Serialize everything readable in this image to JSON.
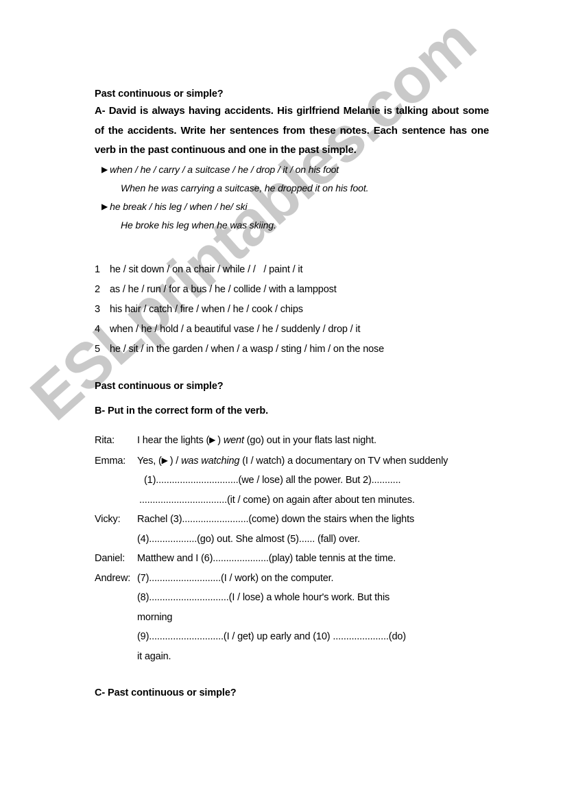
{
  "watermark": {
    "text": "ESLprintables.com",
    "color": "#c9c9c9"
  },
  "section_a": {
    "heading": "Past continuous or simple?",
    "instructions": "A- David is always having accidents. His girlfriend Melanie is talking about some of the accidents. Write her sentences from these notes. Each sentence has one verb in the past continuous and one in the past simple.",
    "bullet_glyph": "▶",
    "examples": [
      {
        "cue": "when / he / carry / a suitcase / he / drop / it / on his foot",
        "answer": "When he was carrying a suitcase, he dropped it on his foot."
      },
      {
        "cue": "he break / his leg / when / he/ ski",
        "answer": "He broke his leg when he was skiing."
      }
    ],
    "items": [
      {
        "number": "1",
        "text": "he / sit down / on a chair / while / /   / paint / it"
      },
      {
        "number": "2",
        "text": "as / he / run / for a bus / he / collide / with a lamppost"
      },
      {
        "number": "3",
        "text": "his hair / catch / fire / when / he / cook / chips"
      },
      {
        "number": "4",
        "text": "when / he / hold / a beautiful vase / he / suddenly / drop / it"
      },
      {
        "number": "5",
        "text": "he / sit / in the garden / when / a wasp / sting / him / on the nose"
      }
    ]
  },
  "section_b": {
    "heading": "Past continuous or simple?",
    "instructions": "B- Put in the correct form of the verb.",
    "lines": [
      {
        "speaker": "Rita:",
        "parts": [
          {
            "t": "I hear the lights ("
          },
          {
            "t": "▶",
            "style": "triangle"
          },
          {
            "t": ") "
          },
          {
            "t": "went",
            "style": "italic"
          },
          {
            "t": " (go) out in your flats last night."
          }
        ]
      },
      {
        "speaker": "Emma:",
        "parts": [
          {
            "t": "Yes, ("
          },
          {
            "t": "▶",
            "style": "triangle"
          },
          {
            "t": ") / "
          },
          {
            "t": "was watching",
            "style": "italic"
          },
          {
            "t": " (I / watch) a documentary on TV when suddenly"
          }
        ]
      },
      {
        "speaker": "",
        "indent": "ind-1",
        "parts": [
          {
            "t": "(1)"
          },
          {
            "t": "...............................",
            "style": "dots"
          },
          {
            "t": "(we / lose) all the power. But 2)"
          },
          {
            "t": "...........",
            "style": "dots"
          }
        ]
      },
      {
        "speaker": "",
        "indent": "ind-2",
        "parts": [
          {
            "t": ".................................",
            "style": "dots"
          },
          {
            "t": "(it / come) on again after about ten minutes."
          }
        ]
      },
      {
        "speaker": "Vicky:",
        "parts": [
          {
            "t": "Rachel (3)"
          },
          {
            "t": ".........................",
            "style": "dots"
          },
          {
            "t": "(come) down the stairs when the lights"
          }
        ]
      },
      {
        "speaker": "",
        "indent": "ind-3",
        "parts": [
          {
            "t": "(4)"
          },
          {
            "t": "..................",
            "style": "dots"
          },
          {
            "t": "(go) out. She almost (5)"
          },
          {
            "t": "......",
            "style": "dots"
          },
          {
            "t": "   (fall) over."
          }
        ]
      },
      {
        "speaker": "Daniel:",
        "parts": [
          {
            "t": "Matthew and I (6)"
          },
          {
            "t": ".....................",
            "style": "dots"
          },
          {
            "t": "(play) table tennis at the time."
          }
        ]
      },
      {
        "speaker": "Andrew:",
        "parts": [
          {
            "t": "(7)"
          },
          {
            "t": "...........................",
            "style": "dots"
          },
          {
            "t": "(I / work) on the computer."
          }
        ]
      },
      {
        "speaker": "",
        "indent": "ind-3",
        "parts": [
          {
            "t": "(8)"
          },
          {
            "t": "..............................",
            "style": "dots"
          },
          {
            "t": "(I / lose) a whole hour's work. But this"
          }
        ]
      },
      {
        "speaker": "",
        "indent": "ind-3",
        "parts": [
          {
            "t": "morning"
          }
        ]
      },
      {
        "speaker": "",
        "indent": "ind-3",
        "parts": [
          {
            "t": "(9)"
          },
          {
            "t": "............................",
            "style": "dots"
          },
          {
            "t": "(I / get) up early and (10) "
          },
          {
            "t": ".....................",
            "style": "dots"
          },
          {
            "t": "(do)"
          }
        ]
      },
      {
        "speaker": "",
        "indent": "ind-3",
        "parts": [
          {
            "t": "it again."
          }
        ]
      }
    ]
  },
  "section_c": {
    "heading": "C- Past continuous or simple?"
  }
}
